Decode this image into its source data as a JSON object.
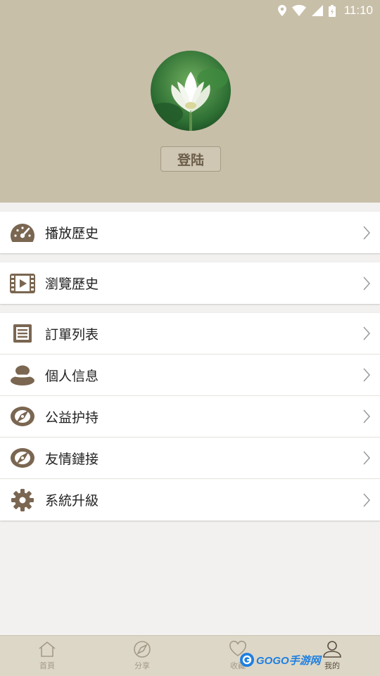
{
  "status_bar": {
    "time": "11:10"
  },
  "profile": {
    "login_label": "登陆"
  },
  "menu": {
    "group1": [
      {
        "label": "播放歷史",
        "icon": "speedometer-icon"
      }
    ],
    "group2": [
      {
        "label": "瀏覽歷史",
        "icon": "film-icon"
      }
    ],
    "group3": [
      {
        "label": "訂單列表",
        "icon": "list-icon"
      },
      {
        "label": "個人信息",
        "icon": "person-icon"
      },
      {
        "label": "公益护持",
        "icon": "compass-icon"
      },
      {
        "label": "友情鏈接",
        "icon": "compass-icon"
      },
      {
        "label": "系統升級",
        "icon": "gear-icon"
      }
    ]
  },
  "tabs": [
    {
      "label": "首頁",
      "icon": "home-icon",
      "active": false
    },
    {
      "label": "分享",
      "icon": "share-icon",
      "active": false
    },
    {
      "label": "收藏",
      "icon": "heart-icon",
      "active": false
    },
    {
      "label": "我的",
      "icon": "profile-icon",
      "active": true
    }
  ],
  "watermark": {
    "text": "GOGO手游网"
  },
  "colors": {
    "header": "#c8bfa9",
    "icon_brown": "#7a6651",
    "tabbar": "#ddd7c8"
  }
}
